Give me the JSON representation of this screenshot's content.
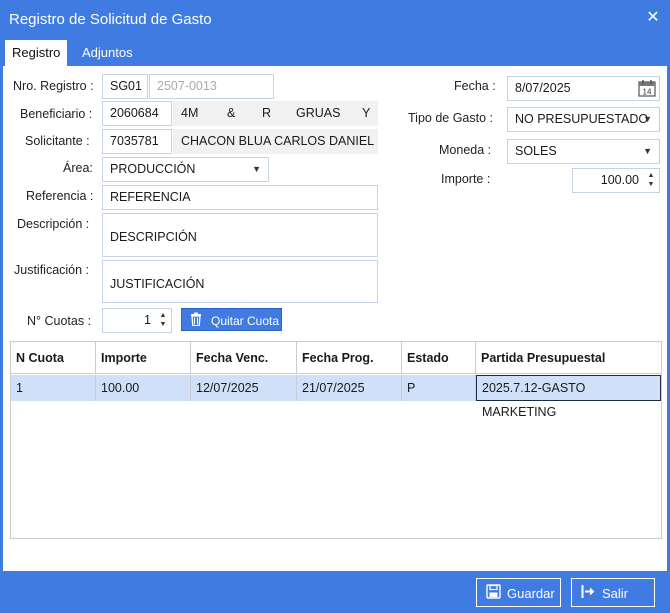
{
  "window": {
    "title": "Registro de Solicitud de Gasto"
  },
  "tabs": [
    {
      "label": "Registro"
    },
    {
      "label": "Adjuntos"
    }
  ],
  "form": {
    "nro_registro": {
      "label": "Nro. Registro :",
      "value": "SG01",
      "value2": "2507-0013"
    },
    "beneficiario": {
      "label": "Beneficiario :",
      "id": "2060684",
      "name_parts": [
        "4M",
        "&",
        "R",
        "GRUAS",
        "Y"
      ]
    },
    "solicitante": {
      "label": "Solicitante :",
      "id": "7035781",
      "name": "CHACON BLUA CARLOS DANIEL"
    },
    "area": {
      "label": "Área:",
      "value": "PRODUCCIÓN"
    },
    "referencia": {
      "label": "Referencia :",
      "value": "REFERENCIA"
    },
    "descripcion": {
      "label": "Descripción :",
      "value": "DESCRIPCIÓN"
    },
    "justificacion": {
      "label": "Justificación :",
      "value": "JUSTIFICACIÓN"
    },
    "cuotas": {
      "label": "N° Cuotas :",
      "value": "1"
    },
    "quitar_cuota": "Quitar Cuota",
    "fecha": {
      "label": "Fecha :",
      "value": "8/07/2025"
    },
    "tipo_gasto": {
      "label": "Tipo de Gasto :",
      "value": "NO PRESUPUESTADO"
    },
    "moneda": {
      "label": "Moneda :",
      "value": "SOLES"
    },
    "importe": {
      "label": "Importe :",
      "value": "100.00"
    }
  },
  "grid": {
    "headers": [
      "N Cuota",
      "Importe",
      "Fecha Venc.",
      "Fecha Prog.",
      "Estado",
      "Partida Presupuestal"
    ],
    "rows": [
      [
        "1",
        "100.00",
        "12/07/2025",
        "21/07/2025",
        "P",
        "2025.7.12-GASTO MARKETING"
      ]
    ]
  },
  "footer": {
    "guardar": "Guardar",
    "salir": "Salir"
  },
  "colors": {
    "accent": "#3f7be0",
    "row_selected": "#cfe0f8"
  },
  "icons": [
    "close-icon",
    "calendar-icon",
    "trash-icon",
    "save-icon",
    "exit-icon"
  ]
}
